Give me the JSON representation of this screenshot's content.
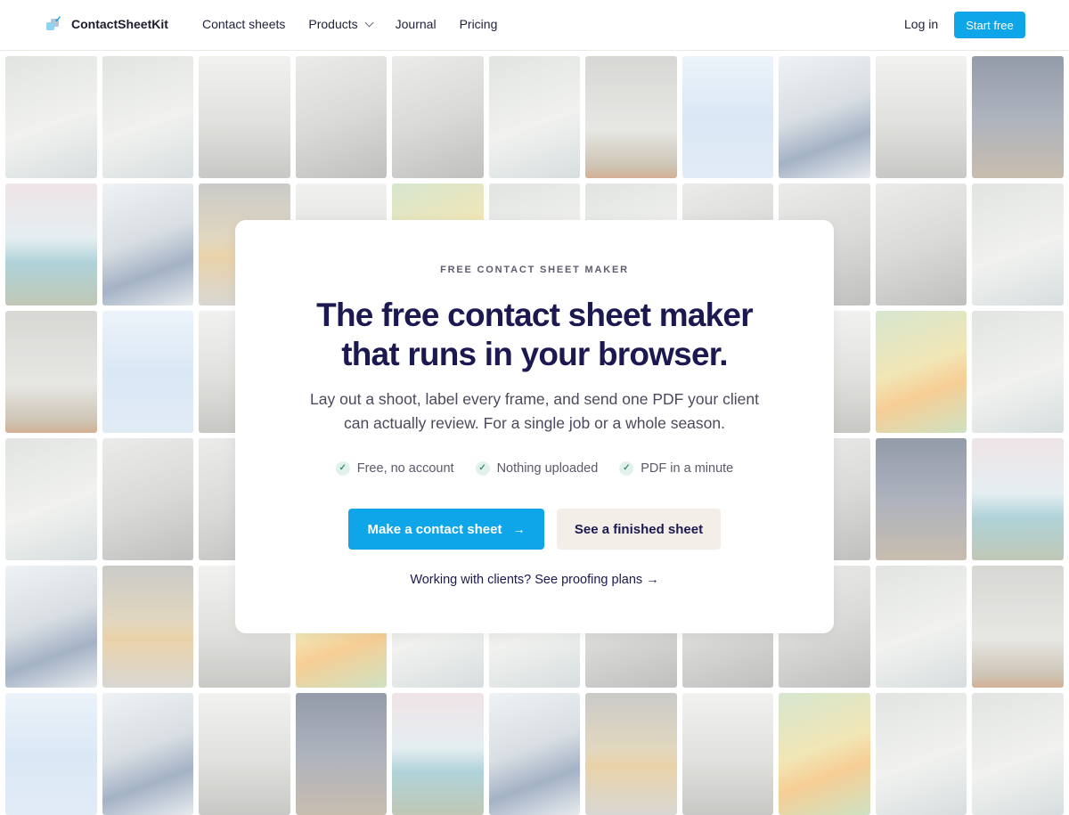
{
  "nav": {
    "brand": "ContactSheetKit",
    "links": [
      {
        "label": "Contact sheets"
      },
      {
        "label": "Products"
      },
      {
        "label": "Journal"
      },
      {
        "label": "Pricing"
      }
    ],
    "login": "Log in",
    "start": "Start free"
  },
  "hero": {
    "eyebrow": "FREE CONTACT SHEET MAKER",
    "headline_line1": "The free contact sheet maker",
    "headline_line2": "that runs in your browser.",
    "subtitle": "Lay out a shoot, label every frame, and send one PDF your client can actually review. For a single job or a whole season.",
    "checks": [
      "Free, no account",
      "Nothing uploaded",
      "PDF in a minute"
    ],
    "primary_cta": "Make a contact sheet",
    "secondary_cta": "See a finished sheet",
    "proof_link": "Working with clients? See proofing plans"
  },
  "colors": {
    "accent": "#0ea5e9",
    "headline": "#1b1950",
    "secondary_button": "#f3efe8"
  },
  "icons": {
    "check": "check-icon",
    "arrow": "arrow-right-icon",
    "chevron": "chevron-down-icon",
    "logo": "logo-icon"
  }
}
